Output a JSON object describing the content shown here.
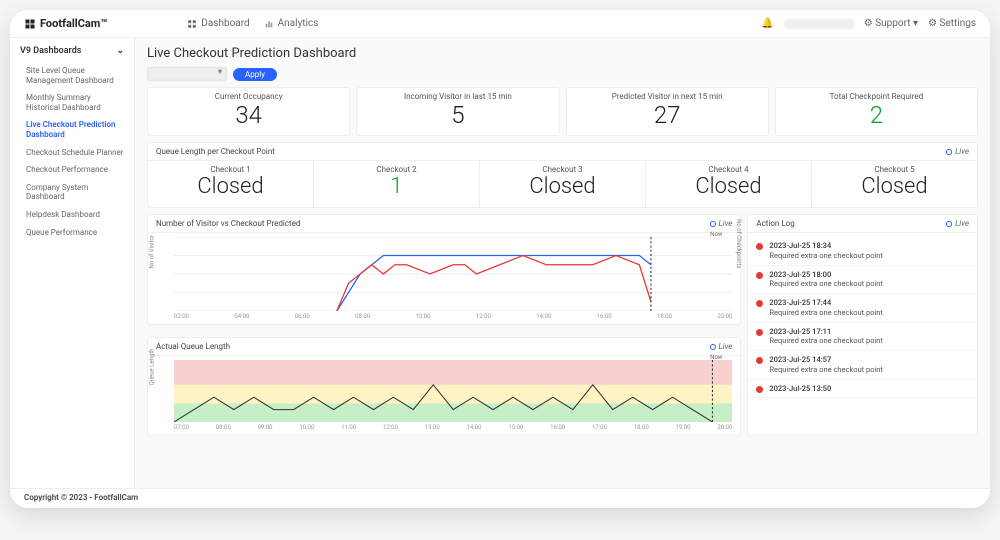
{
  "brand": "FootfallCam™",
  "topnav": [
    {
      "icon": "dashboard",
      "label": "Dashboard"
    },
    {
      "icon": "analytics",
      "label": "Analytics"
    }
  ],
  "topright": {
    "support": "Support",
    "settings": "Settings"
  },
  "sidebar": {
    "heading": "V9 Dashboards",
    "items": [
      "Site Level Queue Management Dashboard",
      "Monthly Summary Historical Dashboard",
      "Live Checkout Prediction Dashboard",
      "Checkout Schedule Planner",
      "Checkout Performance",
      "Company System Dashboard",
      "Helpdesk Dashboard",
      "Queue Performance"
    ],
    "active_index": 2
  },
  "page_title": "Live Checkout Prediction Dashboard",
  "apply_label": "Apply",
  "kpi": [
    {
      "label": "Current Occupancy",
      "value": "34"
    },
    {
      "label": "Incoming Visitor in last 15 min",
      "value": "5"
    },
    {
      "label": "Predicted Visitor in next 15 min",
      "value": "27"
    },
    {
      "label": "Total Checkpoint Required",
      "value": "2",
      "green": true
    }
  ],
  "queue_panel": {
    "title": "Queue Length per Checkout Point",
    "live": "Live",
    "checkouts": [
      {
        "label": "Checkout 1",
        "value": "Closed"
      },
      {
        "label": "Checkout 2",
        "value": "1",
        "green": true
      },
      {
        "label": "Checkout 3",
        "value": "Closed"
      },
      {
        "label": "Checkout 4",
        "value": "Closed"
      },
      {
        "label": "Checkout 5",
        "value": "Closed"
      }
    ]
  },
  "visitor_chart": {
    "title": "Number of Visitor vs Checkout Predicted",
    "live": "Live",
    "ylabel": "No of Visitor",
    "y2label": "No of Checkpoints",
    "now_label": "Now",
    "ticks": [
      "02:00",
      "04:00",
      "06:00",
      "08:00",
      "10:00",
      "12:00",
      "14:00",
      "16:00",
      "18:00",
      "20:00"
    ]
  },
  "queue_chart": {
    "title": "Actual Queue Length",
    "live": "Live",
    "ylabel": "Queue Length",
    "now_label": "Now",
    "ticks": [
      "07:00",
      "08:00",
      "09:00",
      "10:00",
      "11:00",
      "12:00",
      "13:00",
      "14:00",
      "15:00",
      "16:00",
      "17:00",
      "18:00",
      "19:00",
      "20:00"
    ]
  },
  "action_log": {
    "title": "Action Log",
    "live": "Live",
    "items": [
      {
        "time": "2023-Jul-25 18:34",
        "msg": "Required extra one checkout point"
      },
      {
        "time": "2023-Jul-25 18:00",
        "msg": "Required extra one checkout point"
      },
      {
        "time": "2023-Jul-25 17:44",
        "msg": "Required extra one checkout point"
      },
      {
        "time": "2023-Jul-25 17:11",
        "msg": "Required extra one checkout point"
      },
      {
        "time": "2023-Jul-25 14:57",
        "msg": "Required extra one checkout point"
      },
      {
        "time": "2023-Jul-25 13:50",
        "msg": ""
      }
    ]
  },
  "footer": "Copyright © 2023 - FootfallCam",
  "chart_data": [
    {
      "type": "line",
      "title": "Number of Visitor vs Checkout Predicted",
      "xlabel": "",
      "ylabel": "No of Visitor",
      "y2label": "No of Checkpoints",
      "x_ticks": [
        "02:00",
        "04:00",
        "06:00",
        "08:00",
        "10:00",
        "12:00",
        "14:00",
        "16:00",
        "18:00",
        "20:00"
      ],
      "ylim": [
        0,
        8
      ],
      "y2lim": [
        0,
        10
      ],
      "series": [
        {
          "name": "No of Visitor",
          "axis": "y",
          "x": [
            "07:00",
            "07:30",
            "08:00",
            "08:30",
            "09:00",
            "09:30",
            "10:00",
            "10:30",
            "11:00",
            "12:00",
            "13:00",
            "14:00",
            "15:00",
            "16:00",
            "17:00",
            "18:00",
            "19:00",
            "20:00",
            "20:30"
          ],
          "y": [
            0,
            2,
            4,
            5,
            6,
            6,
            6,
            6,
            6,
            6,
            6,
            6,
            6,
            6,
            6,
            6,
            6,
            6,
            5
          ]
        },
        {
          "name": "No of Checkpoints",
          "axis": "y2",
          "x": [
            "07:00",
            "07:30",
            "08:00",
            "08:30",
            "09:00",
            "09:30",
            "10:00",
            "11:00",
            "12:00",
            "12:30",
            "13:00",
            "14:00",
            "15:00",
            "16:00",
            "17:00",
            "18:00",
            "19:00",
            "20:00",
            "20:30"
          ],
          "y": [
            0,
            3,
            4,
            5,
            4,
            5,
            5,
            4,
            5,
            5,
            4,
            5,
            6,
            5,
            5,
            5,
            6,
            5,
            1
          ]
        }
      ]
    },
    {
      "type": "line",
      "title": "Actual Queue Length",
      "xlabel": "",
      "ylabel": "Queue Length",
      "x_ticks": [
        "07:00",
        "08:00",
        "09:00",
        "10:00",
        "11:00",
        "12:00",
        "13:00",
        "14:00",
        "15:00",
        "16:00",
        "17:00",
        "18:00",
        "19:00",
        "20:00"
      ],
      "ylim": [
        0,
        5
      ],
      "bands": [
        {
          "from": 0,
          "to": 1.5,
          "color": "#c7efc7"
        },
        {
          "from": 1.5,
          "to": 3,
          "color": "#fff3c4"
        },
        {
          "from": 3,
          "to": 5,
          "color": "#f8d0d0"
        }
      ],
      "series": [
        {
          "name": "Queue Length",
          "x": [
            "07:00",
            "07:30",
            "08:00",
            "08:30",
            "09:00",
            "09:30",
            "10:00",
            "10:30",
            "11:00",
            "11:30",
            "12:00",
            "12:30",
            "13:00",
            "13:30",
            "14:00",
            "14:30",
            "15:00",
            "15:30",
            "16:00",
            "16:30",
            "17:00",
            "17:30",
            "18:00",
            "18:30",
            "19:00",
            "19:30",
            "20:00",
            "20:30"
          ],
          "y": [
            0,
            1,
            2,
            1,
            2,
            1,
            1,
            2,
            1,
            2,
            1,
            2,
            1,
            3,
            1,
            2,
            1,
            2,
            1,
            2,
            1,
            3,
            1,
            2,
            1,
            2,
            1,
            0
          ]
        }
      ]
    }
  ]
}
